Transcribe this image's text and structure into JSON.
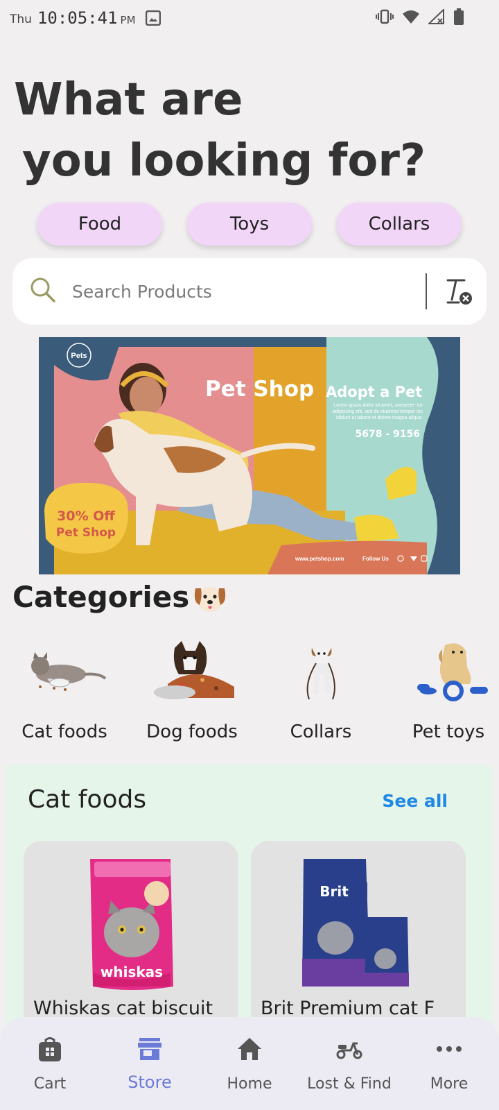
{
  "status_bar": {
    "day": "Thu",
    "time": "10:05:41",
    "ampm": "PM"
  },
  "headline": {
    "line1": "What are",
    "line2": "you looking for?"
  },
  "chips": [
    {
      "label": "Food"
    },
    {
      "label": "Toys"
    },
    {
      "label": "Collars"
    }
  ],
  "search": {
    "placeholder": "Search Products",
    "value": ""
  },
  "banner": {
    "logo": "Pets",
    "title": "Pet Shop",
    "subtitle": "Adopt a Pet",
    "body": "Lorem ipsum dolor sit amet, consecte- tur adipiscing elit, sed do eiusmod tempor inc ididunt ut labore et dolore magna aliqua.",
    "phone": "5678 - 9156",
    "offer_line1": "30% Off",
    "offer_line2": "Pet Shop",
    "website": "www.petshop.com",
    "follow": "Follow Us"
  },
  "categories": {
    "title": "Categories",
    "items": [
      {
        "label": "Cat foods"
      },
      {
        "label": "Dog foods"
      },
      {
        "label": "Collars"
      },
      {
        "label": "Pet toys"
      }
    ]
  },
  "cat_foods": {
    "title": "Cat foods",
    "see_all": "See all",
    "products": [
      {
        "name": "Whiskas cat biscuit",
        "brand": "whiskas"
      },
      {
        "name": "Brit Premium cat F",
        "brand": "Brit"
      }
    ]
  },
  "bottom_nav": {
    "items": [
      {
        "label": "Cart",
        "icon": "shopping-bag-icon"
      },
      {
        "label": "Store",
        "icon": "store-icon"
      },
      {
        "label": "Home",
        "icon": "home-icon"
      },
      {
        "label": "Lost & Find",
        "icon": "scooter-icon"
      },
      {
        "label": "More",
        "icon": "more-horizontal-icon"
      }
    ],
    "active": "Store"
  },
  "colors": {
    "background": "#f1eff0",
    "chip": "#f2d6f8",
    "panel": "#e6f5e9",
    "accent_blue": "#1e88e5",
    "nav_active": "#6b7bd8"
  }
}
